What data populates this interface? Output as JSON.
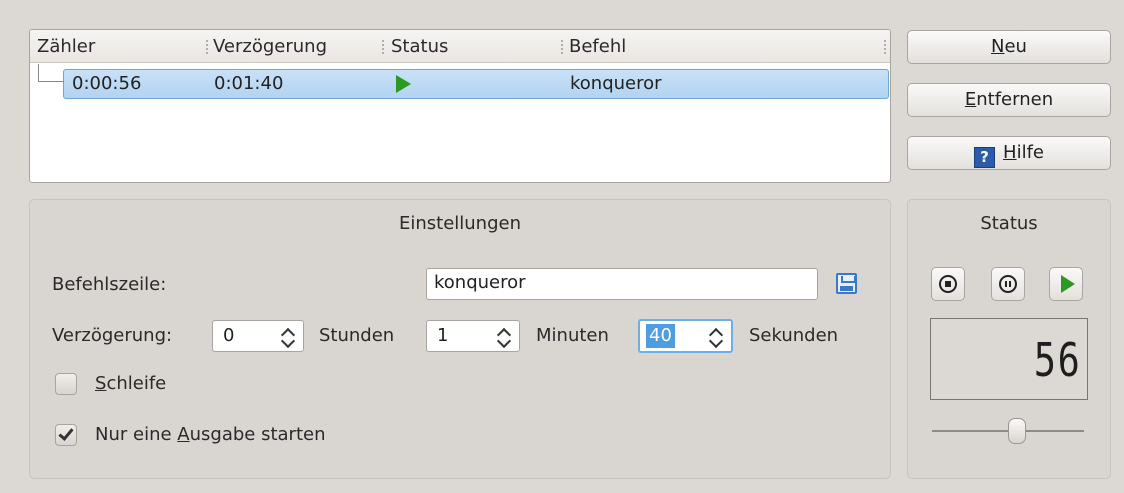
{
  "list": {
    "columns": [
      "Zähler",
      "Verzögerung",
      "Status",
      "Befehl"
    ],
    "rows": [
      {
        "counter": "0:00:56",
        "delay": "0:01:40",
        "status_icon": "play-icon",
        "command": "konqueror"
      }
    ]
  },
  "buttons": {
    "new": {
      "label_prefix": "",
      "mnemonic": "N",
      "label_rest": "eu"
    },
    "remove": {
      "label_prefix": "",
      "mnemonic": "E",
      "label_rest": "ntfernen"
    },
    "help": {
      "icon": "help-icon",
      "mnemonic": "H",
      "label_rest": "ilfe"
    }
  },
  "settings": {
    "title": "Einstellungen",
    "command_label": "Befehlszeile:",
    "command_value": "konqueror",
    "delay_label": "Verzögerung:",
    "hours_value": "0",
    "hours_unit": "Stunden",
    "minutes_value": "1",
    "minutes_unit": "Minuten",
    "seconds_value": "40",
    "seconds_unit": "Sekunden",
    "loop": {
      "mnemonic": "S",
      "label_rest": "chleife",
      "checked": false
    },
    "single": {
      "label_prefix": "Nur eine ",
      "mnemonic": "A",
      "label_rest": "usgabe starten",
      "checked": true
    }
  },
  "status": {
    "title": "Status",
    "lcd_value": "56",
    "slider_fraction": 0.58,
    "colors": {
      "play": "#2a9a20",
      "selection": "#b2d3f1",
      "accent": "#4d9de0"
    }
  }
}
